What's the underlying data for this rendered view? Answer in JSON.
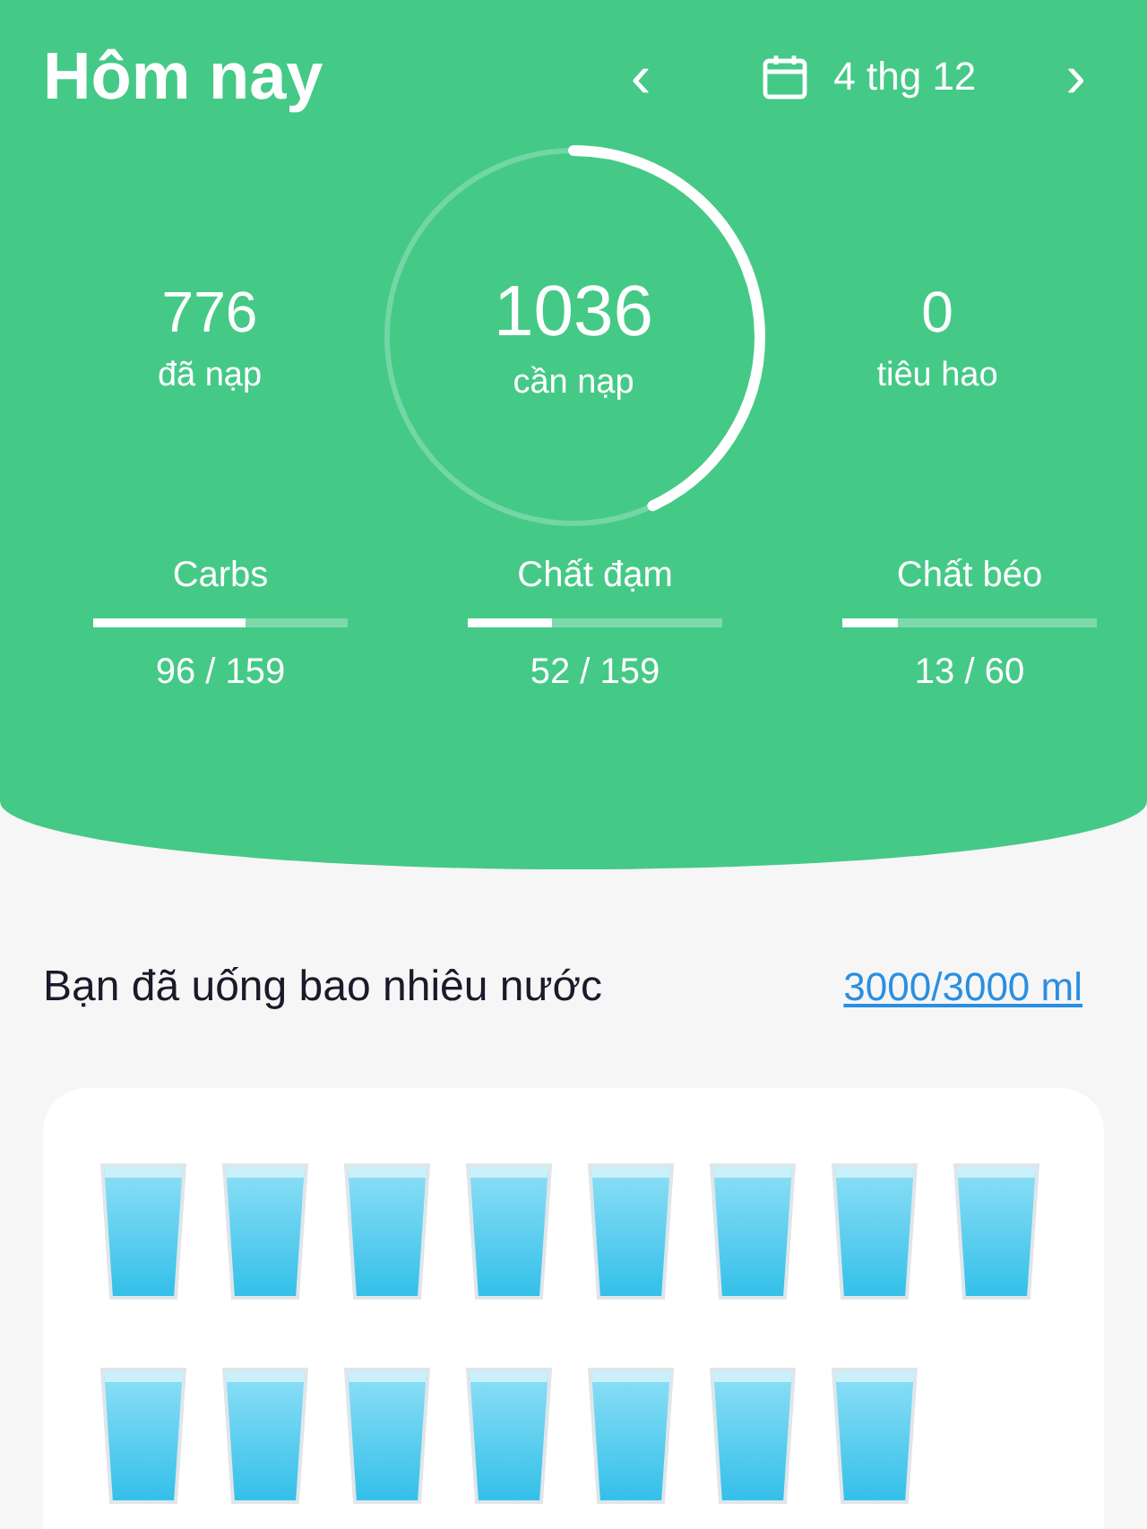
{
  "header": {
    "title": "Hôm nay",
    "prev": "‹",
    "date": "4 thg 12",
    "next": "›"
  },
  "ring": {
    "value": "1036",
    "label": "cần nạp",
    "level": 0.43
  },
  "stats": [
    {
      "value": "776",
      "label": "đã nạp"
    },
    {
      "value": "0",
      "label": "tiêu hao"
    }
  ],
  "macros": [
    {
      "name": "Carbs",
      "level": 0.6,
      "reading": "96 / 159"
    },
    {
      "name": "Chất đạm",
      "level": 0.33,
      "reading": "52 / 159"
    },
    {
      "name": "Chất béo",
      "level": 0.22,
      "reading": "13 / 60"
    }
  ],
  "water": {
    "title": "Bạn đã uống bao nhiêu nước",
    "total": "3000/3000 ml",
    "glasses": [
      {
        "filled": true
      },
      {
        "filled": true
      },
      {
        "filled": true
      },
      {
        "filled": true
      },
      {
        "filled": true
      },
      {
        "filled": true
      },
      {
        "filled": true
      },
      {
        "filled": true
      },
      {
        "filled": true
      },
      {
        "filled": true
      },
      {
        "filled": true
      },
      {
        "filled": true
      },
      {
        "filled": true
      },
      {
        "filled": true
      },
      {
        "filled": true
      }
    ]
  }
}
